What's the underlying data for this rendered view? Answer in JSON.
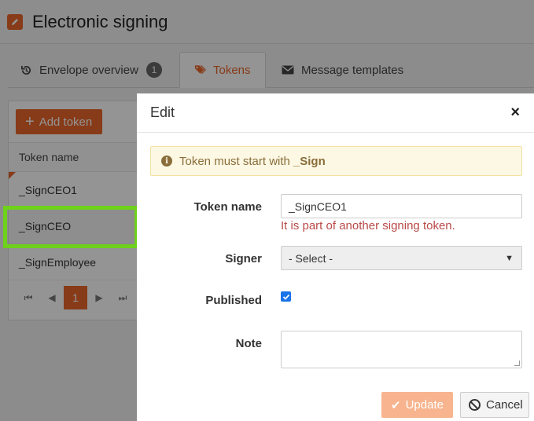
{
  "page": {
    "title": "Electronic signing",
    "title_icon": "edit-icon"
  },
  "tabs": [
    {
      "label": "Envelope overview",
      "icon": "history-icon",
      "badge": "1"
    },
    {
      "label": "Tokens",
      "icon": "tags-icon",
      "active": true
    },
    {
      "label": "Message templates",
      "icon": "envelope-icon"
    }
  ],
  "tokens_panel": {
    "add_label": "Add token",
    "column_header": "Token name",
    "rows": [
      "_SignCEO1",
      "_SignCEO",
      "_SignEmployee"
    ],
    "current_page": "1"
  },
  "modal": {
    "title": "Edit",
    "close_glyph": "×",
    "alert_text": "Token must start with",
    "alert_strong": "_Sign",
    "fields": {
      "token_name_label": "Token name",
      "token_name_value": "_SignCEO1",
      "token_name_error": "It is part of another signing token.",
      "signer_label": "Signer",
      "signer_value": "- Select -",
      "published_label": "Published",
      "published_checked": true,
      "note_label": "Note",
      "note_value": ""
    },
    "update_label": "Update",
    "cancel_label": "Cancel"
  },
  "colors": {
    "accent": "#e8672a",
    "highlight": "#6ed11a",
    "error": "#b94a48",
    "alert_bg": "#fcf8e3"
  }
}
